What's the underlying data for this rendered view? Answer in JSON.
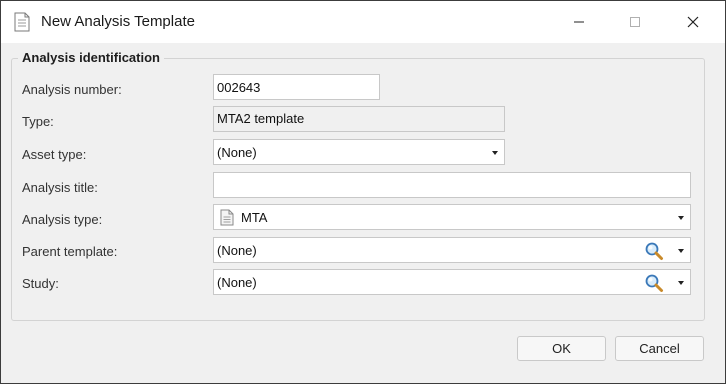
{
  "window": {
    "title": "New Analysis Template",
    "minimize_icon": "minimize-icon",
    "maximize_icon": "maximize-icon",
    "close_icon": "close-icon"
  },
  "group": {
    "title": "Analysis identification"
  },
  "fields": {
    "analysis_number": {
      "label": "Analysis number:",
      "value": "002643"
    },
    "type": {
      "label": "Type:",
      "value": "MTA2 template"
    },
    "asset_type": {
      "label": "Asset type:",
      "value": "(None)"
    },
    "analysis_title": {
      "label": "Analysis title:",
      "value": ""
    },
    "analysis_type": {
      "label": "Analysis type:",
      "value": "MTA",
      "icon": "document-icon"
    },
    "parent_template": {
      "label": "Parent template:",
      "value": "(None)",
      "icon": "search-icon"
    },
    "study": {
      "label": "Study:",
      "value": "(None)",
      "icon": "search-icon"
    }
  },
  "buttons": {
    "ok": "OK",
    "cancel": "Cancel"
  },
  "colors": {
    "titlebar": "#ffffff",
    "dialog_bg": "#f0f0f0",
    "field_bg": "#ffffff",
    "border": "#c8c8c8"
  }
}
